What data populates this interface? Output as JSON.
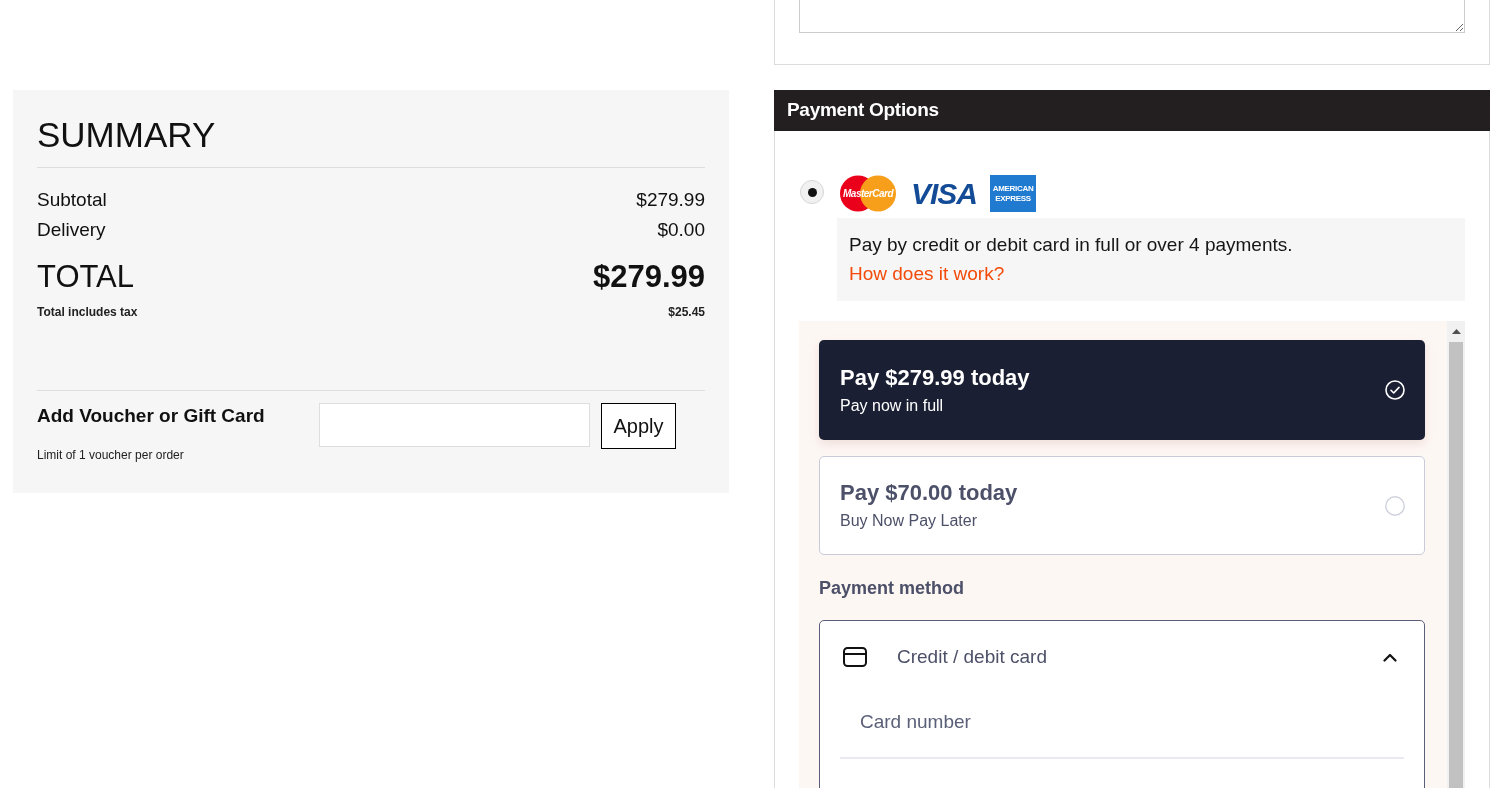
{
  "summary": {
    "title": "SUMMARY",
    "lines": [
      {
        "label": "Subtotal",
        "value": "$279.99"
      },
      {
        "label": "Delivery",
        "value": "$0.00"
      }
    ],
    "total": {
      "label": "TOTAL",
      "value": "$279.99"
    },
    "tax": {
      "label": "Total includes tax",
      "value": "$25.45"
    },
    "voucher": {
      "label": "Add Voucher or Gift Card",
      "note": "Limit of 1 voucher per order",
      "button": "Apply"
    }
  },
  "payment_options": {
    "title": "Payment Options",
    "methods": [
      {
        "selected": true,
        "logos": [
          {
            "kind": "mastercard",
            "text": "MasterCard"
          },
          {
            "kind": "visa",
            "text": "VISA"
          },
          {
            "kind": "amex",
            "text": "AMERICAN EXPRESS"
          }
        ],
        "description": "Pay by credit or debit card in full or over 4 payments.",
        "link": "How does it work?"
      }
    ],
    "plans": [
      {
        "title": "Pay $279.99 today",
        "subtitle": "Pay now in full",
        "selected": true
      },
      {
        "title": "Pay $70.00 today",
        "subtitle": "Buy Now Pay Later",
        "selected": false
      }
    ],
    "method_heading": "Payment method",
    "method": {
      "label": "Credit / debit card",
      "expanded": true,
      "fields": [
        {
          "placeholder": "Card number"
        }
      ]
    }
  }
}
